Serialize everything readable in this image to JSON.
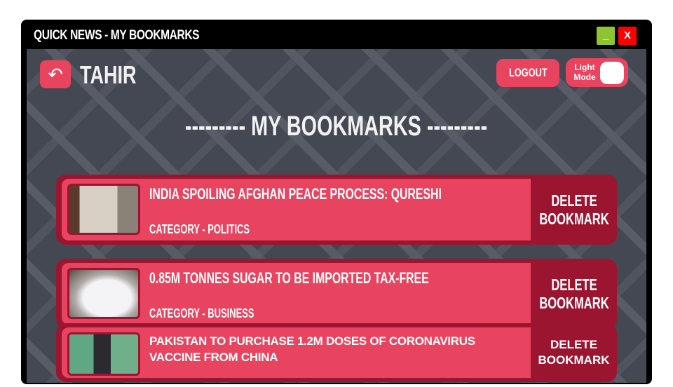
{
  "window": {
    "title": "QUICK NEWS - MY BOOKMARKS",
    "minimize": "_",
    "close": "X"
  },
  "header": {
    "username": "TAHIR",
    "logout": "LOGOUT",
    "theme_toggle": "Light Mode"
  },
  "page_heading": "--------- MY BOOKMARKS ---------",
  "bookmarks": [
    {
      "title": "INDIA SPOILING AFGHAN PEACE PROCESS: QURESHI",
      "category": "CATEGORY - POLITICS",
      "delete": "DELETE BOOKMARK"
    },
    {
      "title": "0.85M TONNES SUGAR TO BE IMPORTED TAX-FREE",
      "category": "CATEGORY - BUSINESS",
      "delete": "DELETE BOOKMARK"
    },
    {
      "title": "PAKISTAN TO PURCHASE 1.2M DOSES OF CORONAVIRUS VACCINE FROM CHINA",
      "category": "",
      "delete": "DELETE BOOKMARK"
    }
  ]
}
